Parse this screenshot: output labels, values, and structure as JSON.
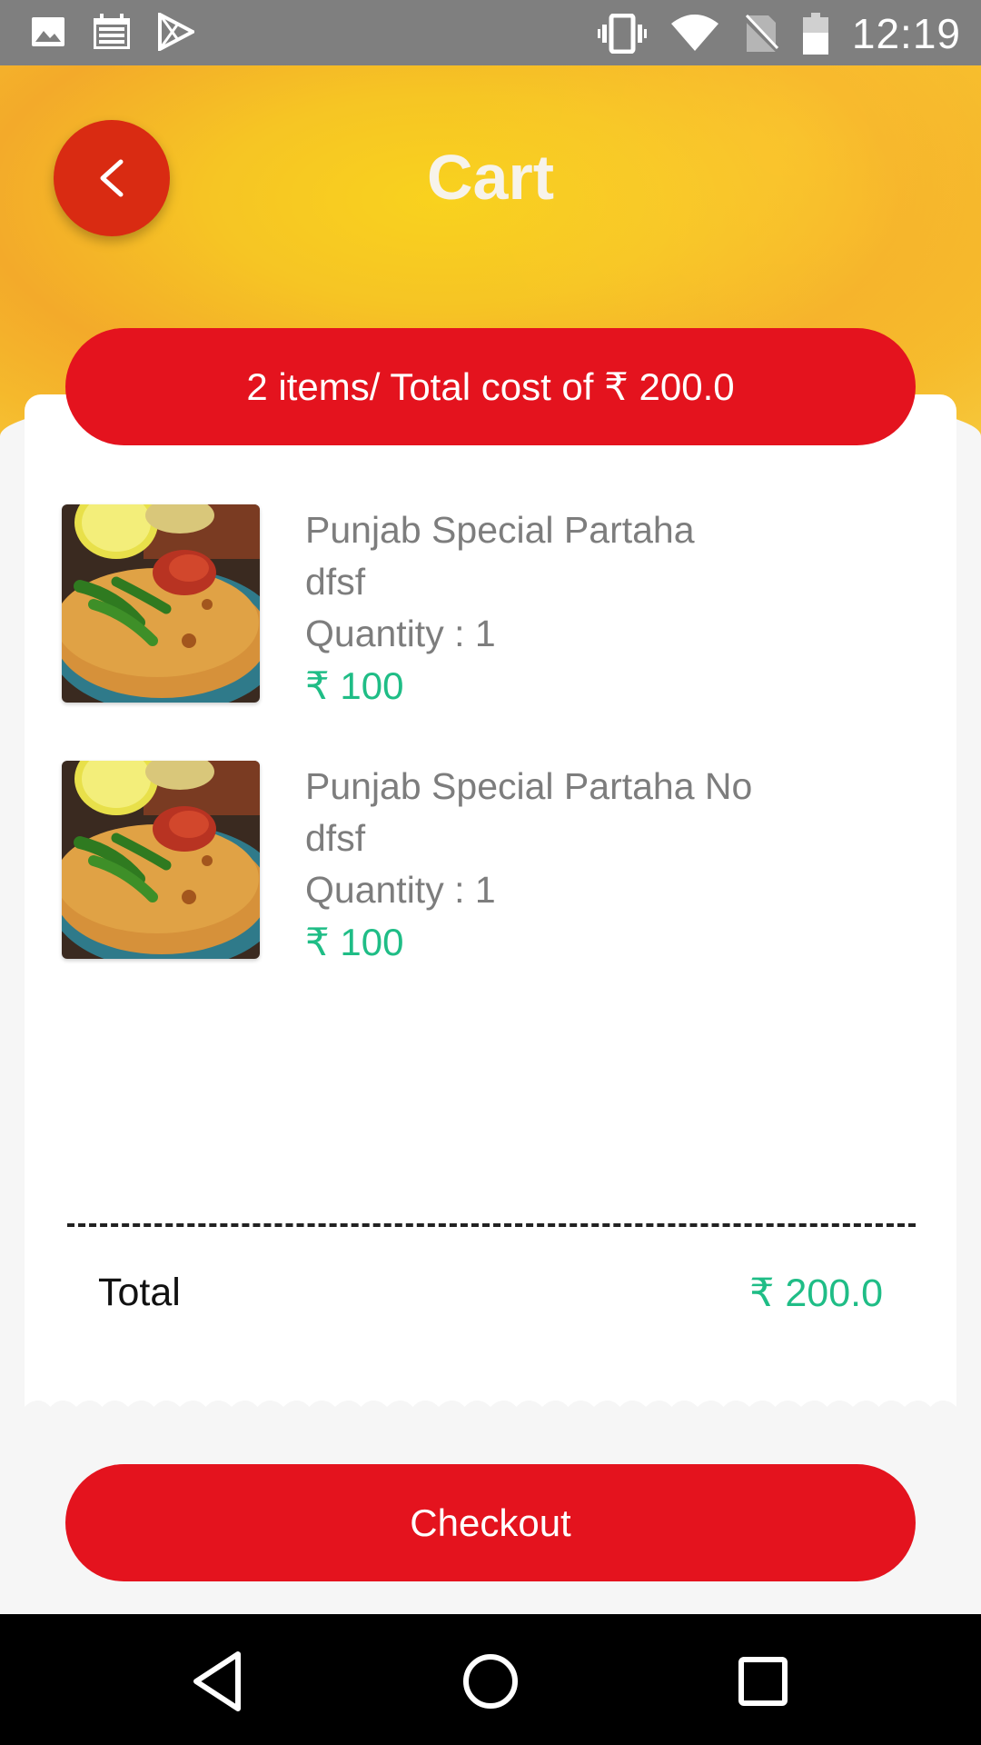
{
  "status_bar": {
    "time": "12:19",
    "left_icons": [
      "image-icon",
      "calendar-icon",
      "play-store-icon"
    ],
    "right_icons": [
      "vibrate-icon",
      "wifi-icon",
      "no-sim-icon",
      "battery-icon"
    ]
  },
  "header": {
    "title": "Cart",
    "back_icon": "chevron-left-icon"
  },
  "summary": {
    "text": "2 items/ Total cost of  ₹ 200.0"
  },
  "items": [
    {
      "name": "Punjab Special Partaha",
      "description": "dfsf",
      "quantity": "Quantity : 1",
      "price": "₹ 100"
    },
    {
      "name": "Punjab Special Partaha No",
      "description": "dfsf",
      "quantity": "Quantity : 1",
      "price": "₹ 100"
    }
  ],
  "total": {
    "label": "Total",
    "value": "₹ 200.0"
  },
  "checkout": {
    "label": "Checkout"
  },
  "nav_bar": [
    "back-triangle-icon",
    "home-circle-icon",
    "recents-square-icon"
  ],
  "colors": {
    "accent_red": "#e4131e",
    "back_button": "#d92b12",
    "price_green": "#1fbd86",
    "header_yellow": "#f6c524"
  }
}
